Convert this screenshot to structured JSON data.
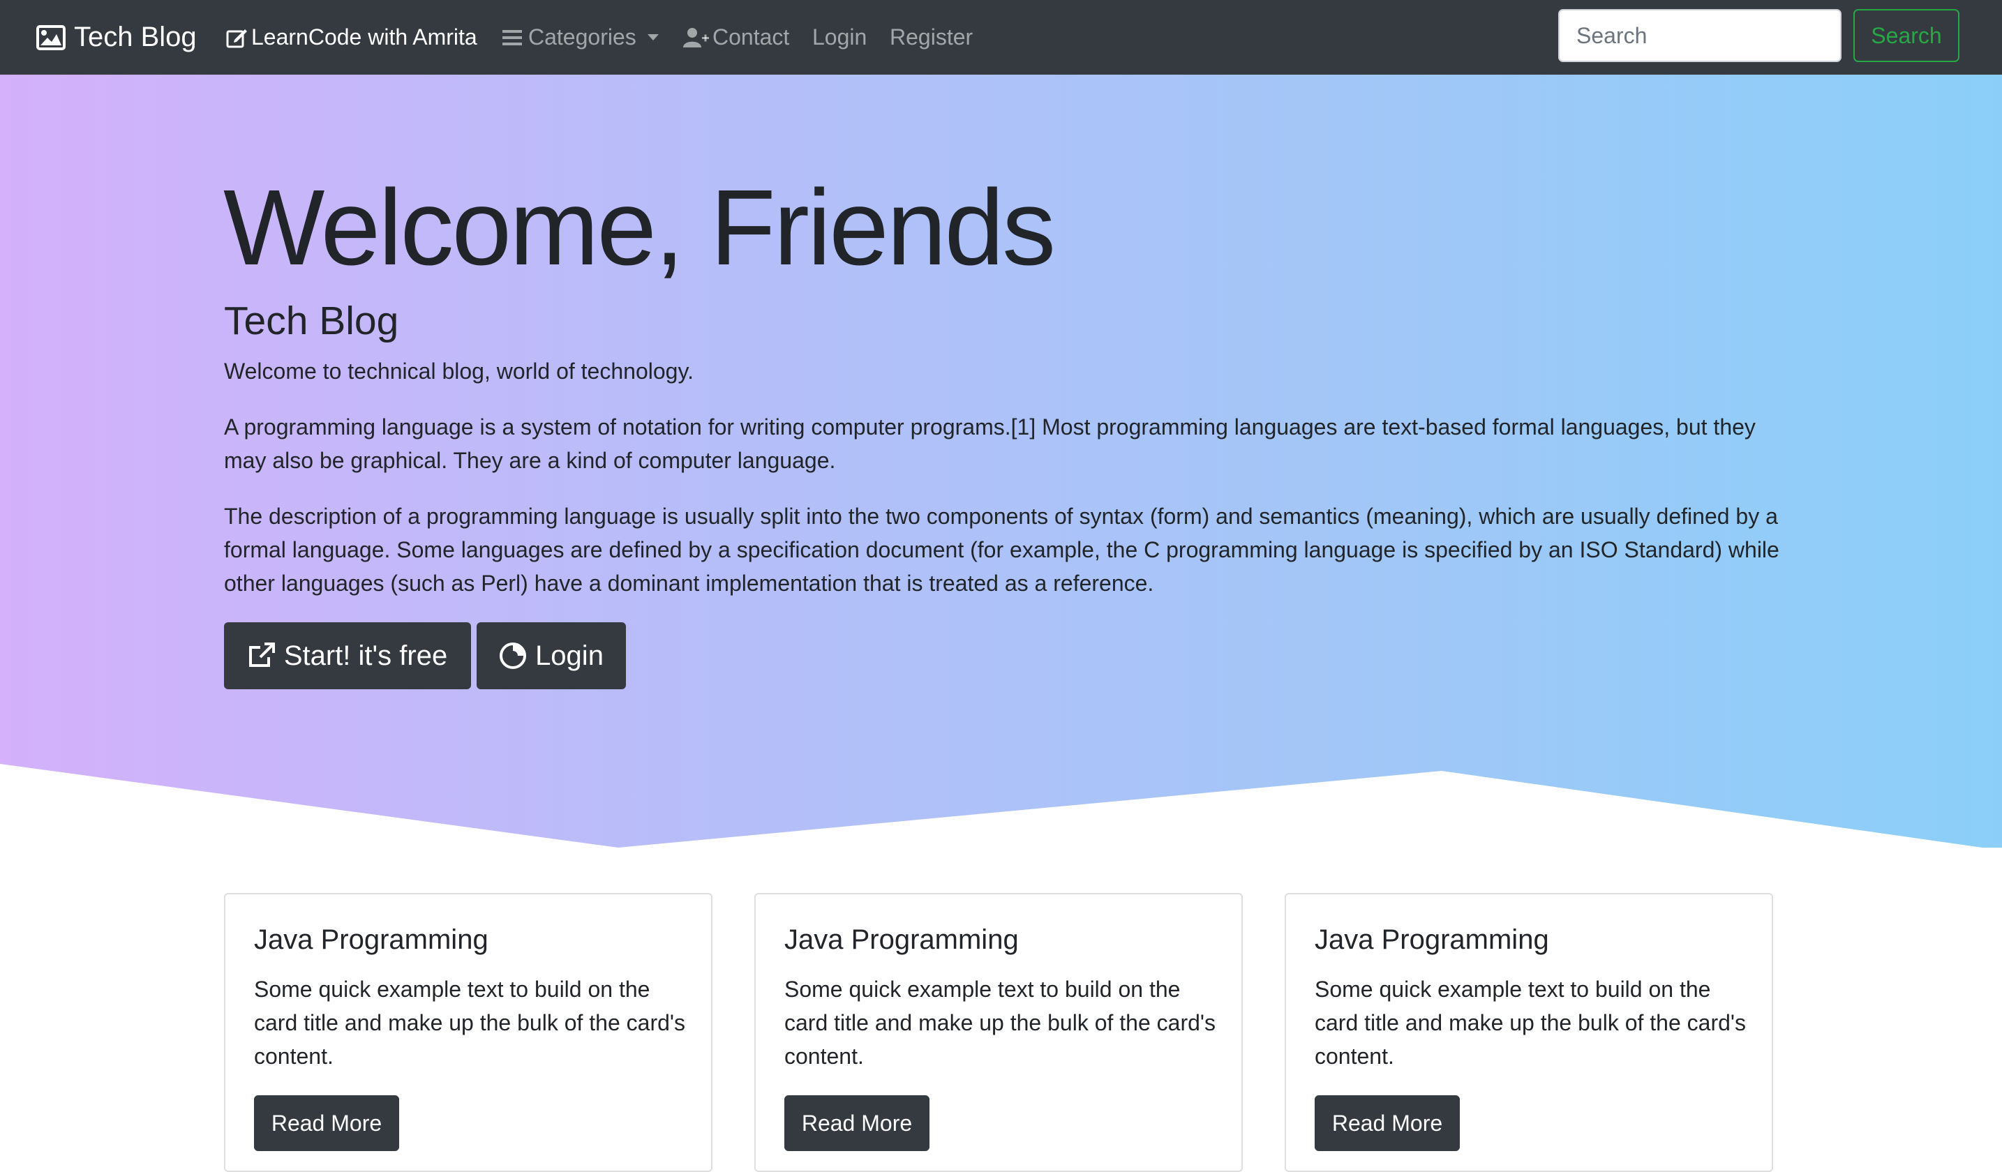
{
  "navbar": {
    "brand": "Tech Blog",
    "links": {
      "learncode": "LearnCode with Amrita",
      "categories": "Categories",
      "contact": "Contact",
      "login": "Login",
      "register": "Register"
    },
    "search": {
      "placeholder": "Search",
      "button_label": "Search"
    }
  },
  "hero": {
    "title": "Welcome, Friends",
    "subtitle": "Tech Blog",
    "paragraphs": [
      "Welcome to technical blog, world of technology.",
      "A programming language is a system of notation for writing computer programs.[1] Most programming languages are text-based formal languages, but they may also be graphical. They are a kind of computer language.",
      "The description of a programming language is usually split into the two components of syntax (form) and semantics (meaning), which are usually defined by a formal language. Some languages are defined by a specification document (for example, the C programming language is specified by an ISO Standard) while other languages (such as Perl) have a dominant implementation that is treated as a reference."
    ],
    "buttons": {
      "start": "Start! it's free",
      "login": "Login"
    }
  },
  "cards": [
    {
      "title": "Java Programming",
      "text": "Some quick example text to build on the card title and make up the bulk of the card's content.",
      "button": "Read More"
    },
    {
      "title": "Java Programming",
      "text": "Some quick example text to build on the card title and make up the bulk of the card's content.",
      "button": "Read More"
    },
    {
      "title": "Java Programming",
      "text": "Some quick example text to build on the card title and make up the bulk of the card's content.",
      "button": "Read More"
    }
  ],
  "colors": {
    "navbar_bg": "#343a40",
    "success": "#28a745",
    "gradient_start": "#d4b1fa",
    "gradient_end": "#8bcff8",
    "button_dark": "#343a40"
  },
  "icons": {
    "brand": "image-icon",
    "learncode": "edit-icon",
    "categories": "bars-icon",
    "contact": "user-plus-icon",
    "start": "external-link-icon",
    "login": "spinner-circle-icon"
  }
}
